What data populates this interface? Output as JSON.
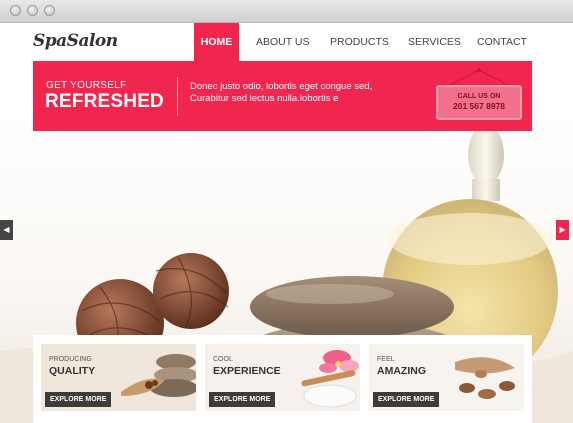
{
  "window": {
    "title_buttons": [
      "close-button",
      "minimize-button",
      "zoom-button"
    ]
  },
  "brand": {
    "logo_text": "SpaSalon",
    "accent_color": "#f0264f"
  },
  "nav": {
    "items": [
      {
        "label": "HOME",
        "active": true
      },
      {
        "label": "ABOUT US",
        "active": false
      },
      {
        "label": "PRODUCTS",
        "active": false
      },
      {
        "label": "SERVICES",
        "active": false
      },
      {
        "label": "CONTACT",
        "active": false
      }
    ]
  },
  "banner": {
    "kicker": "GET YOURSELF",
    "headline": "REFRESHED",
    "text": "Donec justo odio, lobortis eget congue sed, Curabitur sed lectus nulla.lobortis e",
    "sign": {
      "line1": "CALL US ON",
      "line2": "201 567 8978"
    }
  },
  "slider": {
    "prev_icon": "chevron-left-icon",
    "next_icon": "chevron-right-icon"
  },
  "cards": [
    {
      "small": "PRODUCING",
      "big": "QUALITY",
      "button": "EXPLORE MORE"
    },
    {
      "small": "COOL",
      "big": "EXPERIENCE",
      "button": "EXPLORE MORE"
    },
    {
      "small": "FEEL",
      "big": "AMAZING",
      "button": "EXPLORE MORE"
    }
  ]
}
